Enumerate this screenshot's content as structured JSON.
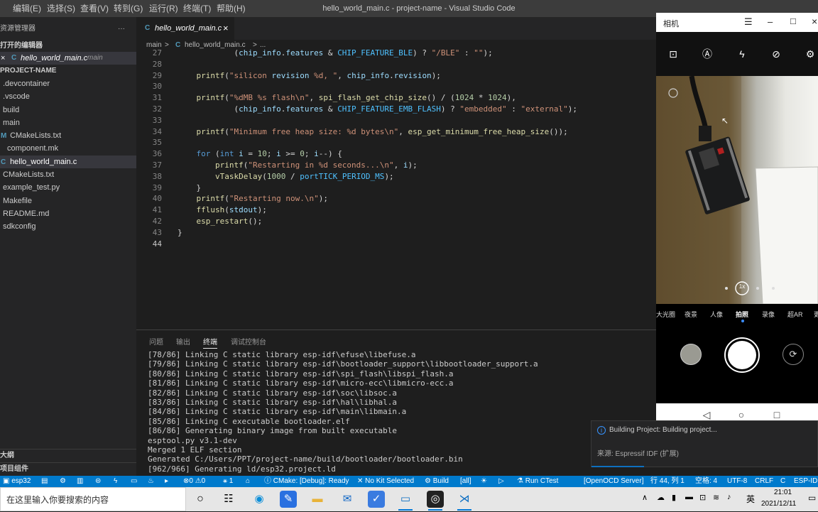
{
  "window": {
    "title": "hello_world_main.c - project-name - Visual Studio Code",
    "menu": [
      "编辑(E)",
      "选择(S)",
      "查看(V)",
      "转到(G)",
      "运行(R)",
      "终端(T)",
      "帮助(H)"
    ]
  },
  "sidebar": {
    "header": "资源管理器",
    "more": "···",
    "open_editors": "打开的编辑器",
    "open_file": {
      "close": "×",
      "icon": "C",
      "name": "hello_world_main.c",
      "folder": "main"
    },
    "project": "PROJECT-NAME",
    "items": [
      {
        "icon": "",
        "label": ".devcontainer"
      },
      {
        "icon": "",
        "label": ".vscode"
      },
      {
        "icon": "",
        "label": "build"
      },
      {
        "icon": "",
        "label": "main"
      },
      {
        "icon": "M",
        "label": "CMakeLists.txt"
      },
      {
        "icon": "",
        "label": "component.mk"
      },
      {
        "icon": "C",
        "label": "hello_world_main.c"
      },
      {
        "icon": "",
        "label": "CMakeLists.txt"
      },
      {
        "icon": "",
        "label": "example_test.py"
      },
      {
        "icon": "",
        "label": "Makefile"
      },
      {
        "icon": "",
        "label": "README.md"
      },
      {
        "icon": "",
        "label": "sdkconfig"
      }
    ],
    "bottom": [
      "大纲",
      "项目组件"
    ]
  },
  "editor": {
    "tab": {
      "icon": "C",
      "label": "hello_world_main.c",
      "close": "×"
    },
    "breadcrumb": {
      "folder": "main",
      "sep": ">",
      "icon": "C",
      "file": "hello_world_main.c",
      "tail": "..."
    },
    "lines": [
      {
        "no": "27",
        "text": "            (chip_info.features & CHIP_FEATURE_BLE) ? \"/BLE\" : \"\");"
      },
      {
        "no": "28",
        "text": ""
      },
      {
        "no": "29",
        "text": "    printf(\"silicon revision %d, \", chip_info.revision);"
      },
      {
        "no": "30",
        "text": ""
      },
      {
        "no": "31",
        "text": "    printf(\"%dMB %s flash\\n\", spi_flash_get_chip_size() / (1024 * 1024),"
      },
      {
        "no": "32",
        "text": "            (chip_info.features & CHIP_FEATURE_EMB_FLASH) ? \"embedded\" : \"external\");"
      },
      {
        "no": "33",
        "text": ""
      },
      {
        "no": "34",
        "text": "    printf(\"Minimum free heap size: %d bytes\\n\", esp_get_minimum_free_heap_size());"
      },
      {
        "no": "35",
        "text": ""
      },
      {
        "no": "36",
        "text": "    for (int i = 10; i >= 0; i--) {"
      },
      {
        "no": "37",
        "text": "        printf(\"Restarting in %d seconds...\\n\", i);"
      },
      {
        "no": "38",
        "text": "        vTaskDelay(1000 / portTICK_PERIOD_MS);"
      },
      {
        "no": "39",
        "text": "    }"
      },
      {
        "no": "40",
        "text": "    printf(\"Restarting now.\\n\");"
      },
      {
        "no": "41",
        "text": "    fflush(stdout);"
      },
      {
        "no": "42",
        "text": "    esp_restart();"
      },
      {
        "no": "43",
        "text": "}"
      },
      {
        "no": "44",
        "text": ""
      }
    ]
  },
  "panel": {
    "tabs": [
      "问题",
      "输出",
      "终端",
      "调试控制台"
    ],
    "active_tab": "终端",
    "terminal": [
      "[78/86] Linking C static library esp-idf\\efuse\\libefuse.a",
      "[79/86] Linking C static library esp-idf\\bootloader_support\\libbootloader_support.a",
      "[80/86] Linking C static library esp-idf\\spi_flash\\libspi_flash.a",
      "[81/86] Linking C static library esp-idf\\micro-ecc\\libmicro-ecc.a",
      "[82/86] Linking C static library esp-idf\\soc\\libsoc.a",
      "[83/86] Linking C static library esp-idf\\hal\\libhal.a",
      "[84/86] Linking C static library esp-idf\\main\\libmain.a",
      "[85/86] Linking C executable bootloader.elf",
      "[86/86] Generating binary image from built executable",
      "esptool.py v3.1-dev",
      "Merged 1 ELF section",
      "Generated C:/Users/PPT/project-name/build/bootloader/bootloader.bin",
      "[962/966] Generating ld/esp32.project.ld"
    ]
  },
  "camera": {
    "title": "相机",
    "modes": [
      "大光圈",
      "夜景",
      "人像",
      "拍照",
      "录像",
      "超AR",
      "更"
    ],
    "active_mode": "拍照",
    "zoom": "1x"
  },
  "notification": {
    "title": "Building Project: Building project...",
    "source": "来源: Espressif IDF (扩展)"
  },
  "statusbar": {
    "target": "esp32",
    "problems": "⊗0 ⚠0",
    "ports": "1",
    "cmake": "CMake: [Debug]: Ready",
    "kit": "No Kit Selected",
    "build": "Build",
    "all": "[all]",
    "ctest": "Run CTest",
    "openocd": "[OpenOCD Server]",
    "position": "行 44, 列 1",
    "spaces": "空格: 4",
    "encoding": "UTF-8",
    "eol": "CRLF",
    "language": "C",
    "ext": "ESP-IDF"
  },
  "taskbar": {
    "search": "在这里输入你要搜索的内容",
    "time": "21:01",
    "date": "2021/12/11",
    "ime": "英"
  }
}
